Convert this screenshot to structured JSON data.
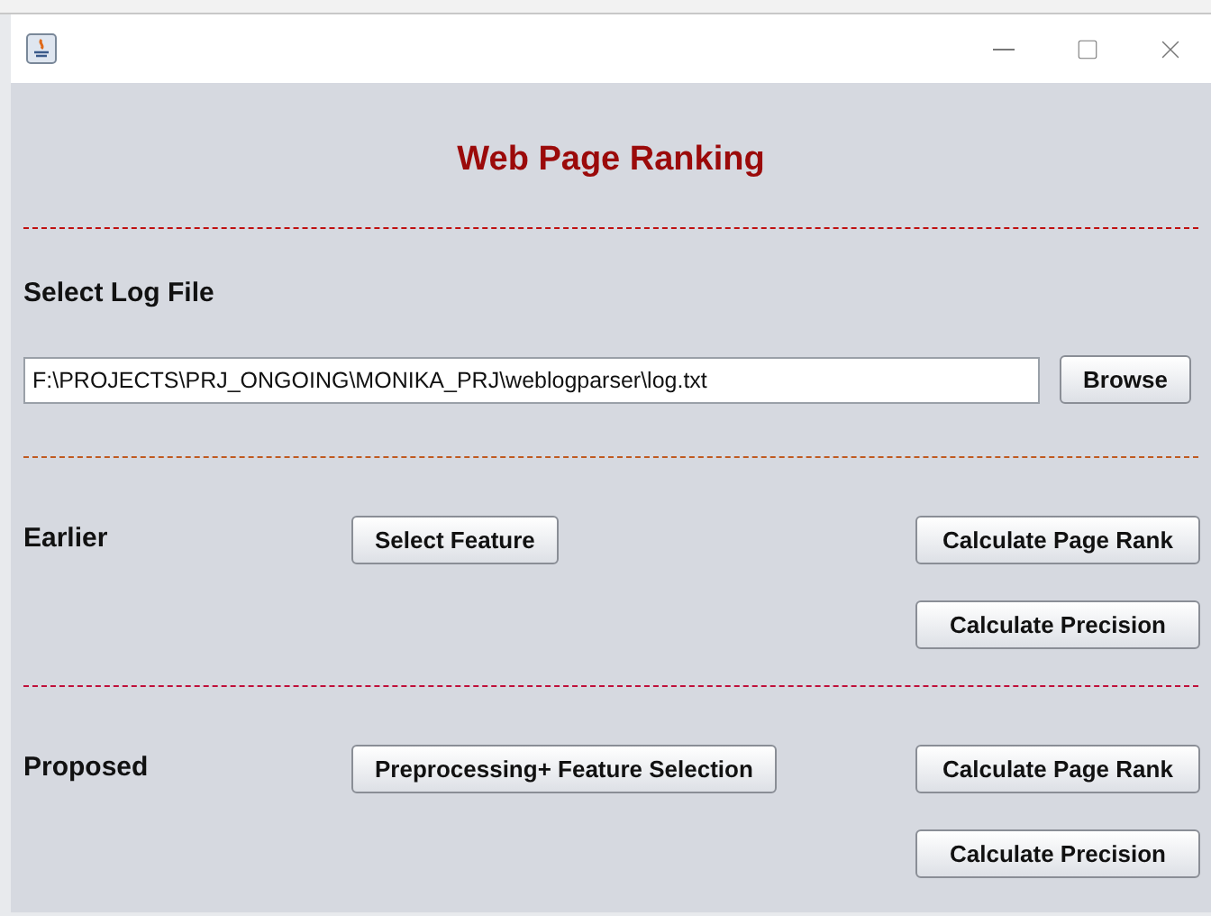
{
  "window": {
    "title": "Web Page Ranking"
  },
  "log_file": {
    "label": "Select Log File",
    "value": "F:\\PROJECTS\\PRJ_ONGOING\\MONIKA_PRJ\\weblogparser\\log.txt",
    "button": "Browse"
  },
  "sections": [
    {
      "label": "Earlier",
      "feature_button": "Select Feature",
      "rank_button": "Calculate Page Rank",
      "precision_button": "Calculate Precision"
    },
    {
      "label": "Proposed",
      "feature_button": "Preprocessing+ Feature Selection",
      "rank_button": "Calculate Page Rank",
      "precision_button": "Calculate Precision"
    }
  ]
}
